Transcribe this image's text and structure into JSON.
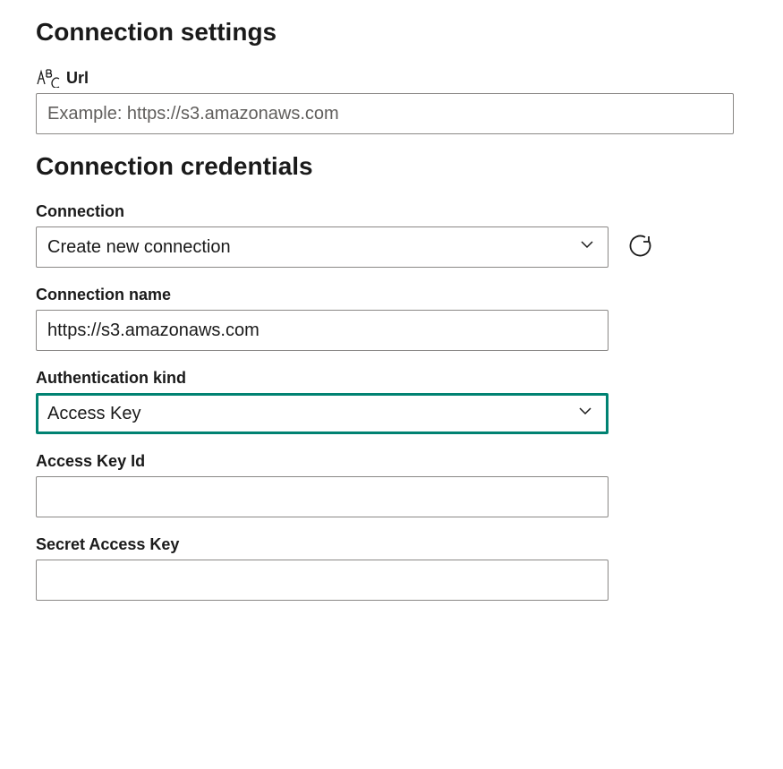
{
  "settings": {
    "heading": "Connection settings",
    "url": {
      "label": "Url",
      "placeholder": "Example: https://s3.amazonaws.com",
      "value": "",
      "icon": "abc-type-icon"
    }
  },
  "credentials": {
    "heading": "Connection credentials",
    "connection": {
      "label": "Connection",
      "selected": "Create new connection"
    },
    "connection_name": {
      "label": "Connection name",
      "value": "https://s3.amazonaws.com"
    },
    "auth_kind": {
      "label": "Authentication kind",
      "selected": "Access Key"
    },
    "access_key_id": {
      "label": "Access Key Id",
      "value": ""
    },
    "secret_access_key": {
      "label": "Secret Access Key",
      "value": ""
    }
  }
}
